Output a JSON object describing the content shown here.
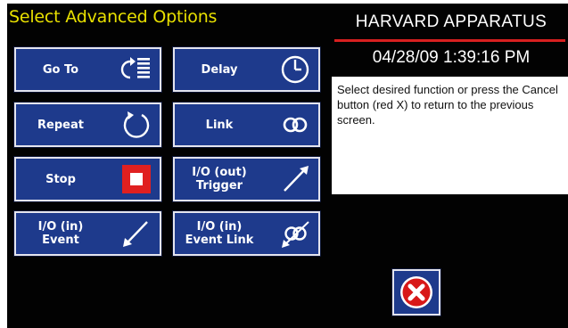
{
  "header": {
    "title": "Select Advanced Options",
    "brand": "HARVARD APPARATUS",
    "datetime": "04/28/09 1:39:16 PM"
  },
  "info": {
    "message": "Select desired function or press the Cancel button (red X) to return to the previous screen."
  },
  "buttons": {
    "goto": {
      "label": "Go To",
      "icon": "goto-list-icon"
    },
    "delay": {
      "label": "Delay",
      "icon": "clock-icon"
    },
    "repeat": {
      "label": "Repeat",
      "icon": "repeat-icon"
    },
    "link": {
      "label": "Link",
      "icon": "link-rings-icon"
    },
    "stop": {
      "label": "Stop",
      "icon": "stop-icon"
    },
    "io_out_trigger": {
      "line1": "I/O (out)",
      "line2": "Trigger",
      "icon": "arrow-up-right-icon"
    },
    "io_in_event": {
      "line1": "I/O (in)",
      "line2": "Event",
      "icon": "arrow-down-left-icon"
    },
    "io_in_event_link": {
      "line1": "I/O (in)",
      "line2": "Event Link",
      "icon": "event-link-icon"
    }
  },
  "cancel": {
    "icon": "cancel-x-icon"
  },
  "colors": {
    "background": "#020202",
    "title": "#e8e000",
    "button": "#1e3a8c",
    "brand_rule": "#d82020",
    "stop_red": "#e02020",
    "cancel_red": "#d81818"
  }
}
